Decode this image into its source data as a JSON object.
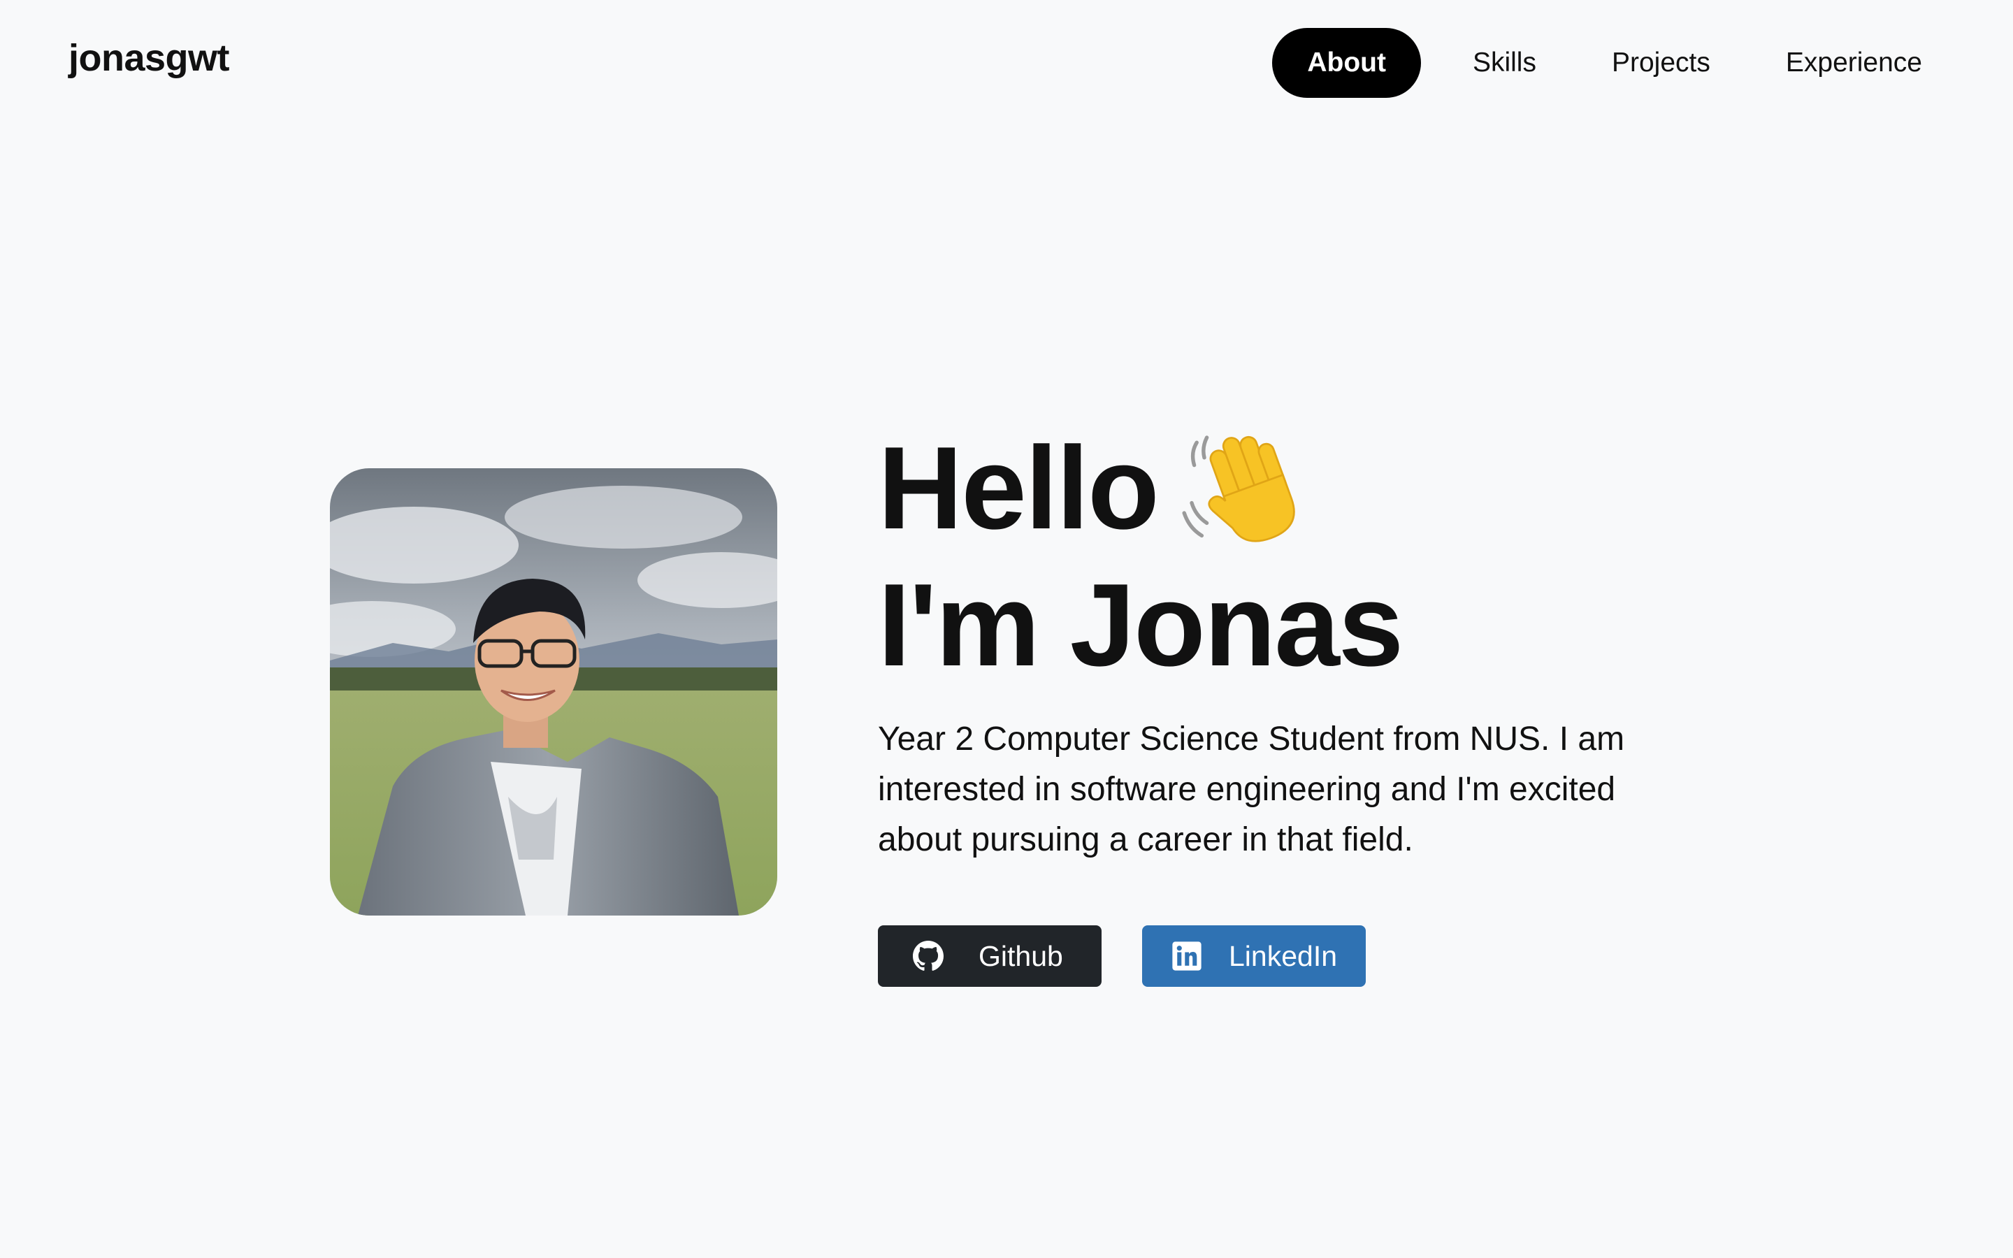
{
  "navbar": {
    "brand": "jonasgwt",
    "links": [
      {
        "label": "About",
        "active": true
      },
      {
        "label": "Skills",
        "active": false
      },
      {
        "label": "Projects",
        "active": false
      },
      {
        "label": "Experience",
        "active": false
      }
    ]
  },
  "hero": {
    "greeting": "Hello",
    "greeting_icon": "waving-hand-icon",
    "name_line": "I'm Jonas",
    "intro": "Year 2 Computer Science Student from NUS. I am interested in software engineering and I'm excited about pursuing a career in that field.",
    "photo_icon": "profile-photo",
    "buttons": [
      {
        "label": "Github",
        "icon": "github-icon",
        "color": "#212529"
      },
      {
        "label": "LinkedIn",
        "icon": "linkedin-icon",
        "color": "#2f72b3"
      }
    ]
  },
  "colors": {
    "background": "#f8f9fa",
    "nav_active_bg": "#000000",
    "text": "#111111"
  }
}
